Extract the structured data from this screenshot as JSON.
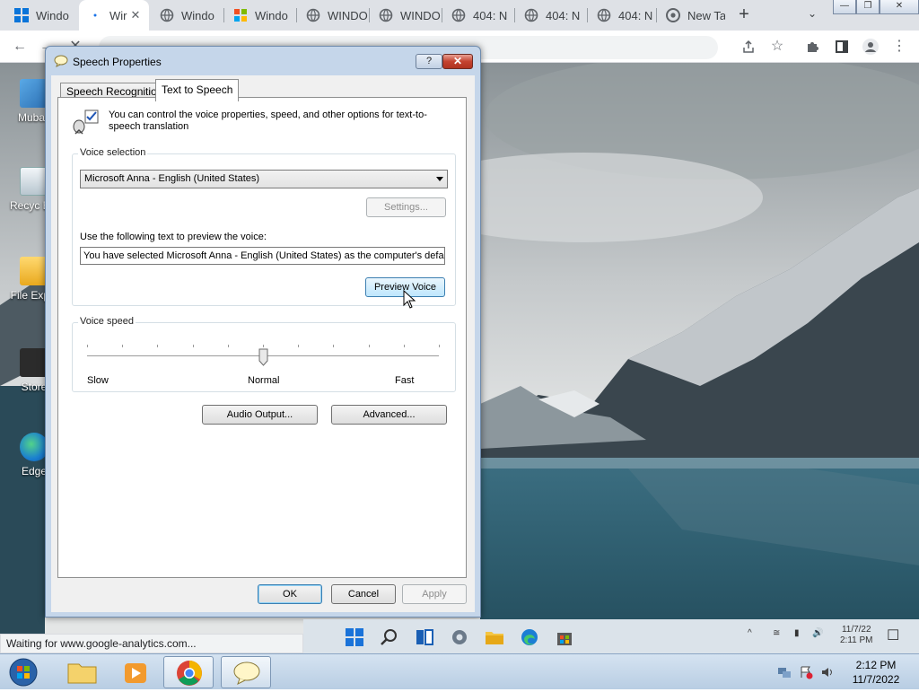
{
  "browser": {
    "tabs": [
      {
        "label": "Windo",
        "icon": "windows-logo-icon",
        "active": false
      },
      {
        "label": "Wir",
        "icon": "loading-icon",
        "active": true
      },
      {
        "label": "Windo",
        "icon": "globe-icon",
        "active": false
      },
      {
        "label": "Windo",
        "icon": "windows-flag-icon",
        "active": false
      },
      {
        "label": "WINDO",
        "icon": "globe-icon",
        "active": false
      },
      {
        "label": "WINDO",
        "icon": "globe-icon",
        "active": false
      },
      {
        "label": "404: N",
        "icon": "globe-icon",
        "active": false
      },
      {
        "label": "404: N",
        "icon": "globe-icon",
        "active": false
      },
      {
        "label": "404: N",
        "icon": "globe-icon",
        "active": false
      },
      {
        "label": "New Ta",
        "icon": "chrome-icon",
        "active": false
      }
    ],
    "omnibox": "",
    "status_text": "Waiting for www.google-analytics.com..."
  },
  "desktop_icons": [
    {
      "label": "Mubas",
      "name": "desktop-icon-user"
    },
    {
      "label": "Recyc Bin",
      "name": "desktop-icon-recycle-bin"
    },
    {
      "label": "File Explo",
      "name": "desktop-icon-file-explorer"
    },
    {
      "label": "Store",
      "name": "desktop-icon-store"
    },
    {
      "label": "Edge",
      "name": "desktop-icon-edge"
    }
  ],
  "dialog": {
    "title": "Speech Properties",
    "help_label": "?",
    "tabs": [
      {
        "label": "Speech Recognition",
        "active": false
      },
      {
        "label": "Text to Speech",
        "active": true
      }
    ],
    "intro_text": "You can control the voice properties, speed, and other options for text-to-speech translation",
    "voice_selection": {
      "group_label": "Voice selection",
      "selected_voice": "Microsoft Anna - English (United States)",
      "settings_label": "Settings...",
      "preview_prompt": "Use the following text to preview the voice:",
      "preview_text": "You have selected Microsoft Anna - English (United States) as the computer's default",
      "preview_button": "Preview Voice"
    },
    "voice_speed": {
      "group_label": "Voice speed",
      "slow_label": "Slow",
      "normal_label": "Normal",
      "fast_label": "Fast",
      "position": 0.5
    },
    "audio_output_label": "Audio Output...",
    "advanced_label": "Advanced...",
    "ok_label": "OK",
    "cancel_label": "Cancel",
    "apply_label": "Apply"
  },
  "vm_taskbar": {
    "clock_time": "11/7/22",
    "clock_sub": "2:11 PM"
  },
  "host_taskbar": {
    "time": "2:12 PM",
    "date": "11/7/2022"
  }
}
